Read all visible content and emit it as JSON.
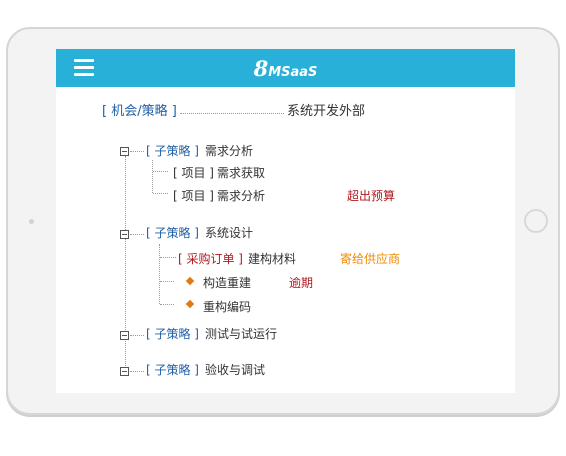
{
  "app": {
    "logo_prefix": "8",
    "logo_suffix": "MSaaS"
  },
  "root": {
    "tag": "[ 机会/策略 ]",
    "label": "系统开发外部"
  },
  "nodes": [
    {
      "tag": "[ 子策略 ]",
      "label": "需求分析",
      "children": [
        {
          "tag": "[ 项目 ]",
          "label": "需求获取",
          "status": ""
        },
        {
          "tag": "[ 项目 ]",
          "label": "需求分析",
          "status": "超出预算"
        }
      ]
    },
    {
      "tag": "[ 子策略 ]",
      "label": "系统设计",
      "children": [
        {
          "tag": "[ 采购订单 ]",
          "label": "建构材料",
          "status": "寄给供应商"
        },
        {
          "tag": "",
          "label": "构造重建",
          "status": "逾期"
        },
        {
          "tag": "",
          "label": "重构编码",
          "status": ""
        }
      ]
    },
    {
      "tag": "[ 子策略 ]",
      "label": "测试与试运行"
    },
    {
      "tag": "[ 子策略 ]",
      "label": "验收与调试"
    }
  ],
  "colors": {
    "header": "#29b0d9",
    "tag_blue": "#1f5fa6",
    "status_red": "#b0181e",
    "status_orange": "#f08a00",
    "bullet": "#e07b14"
  }
}
